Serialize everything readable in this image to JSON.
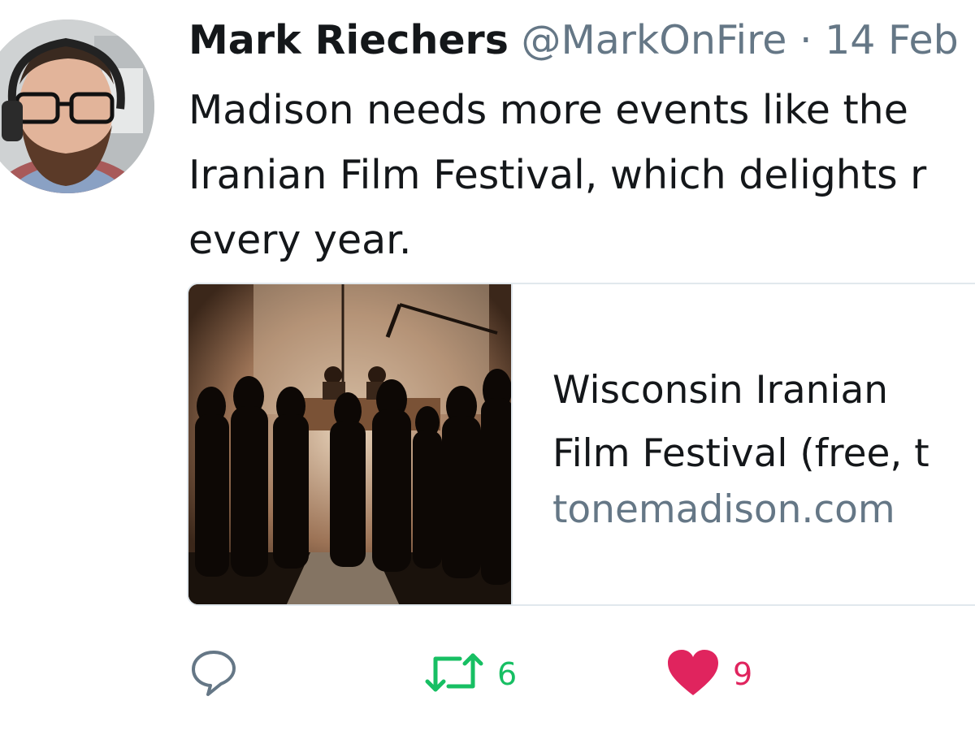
{
  "tweet": {
    "author_name": "Mark Riechers",
    "handle": "@MarkOnFire",
    "separator": "·",
    "timestamp": "14 Feb",
    "text_lines": [
      "Madison needs more events like the",
      "Iranian Film Festival, which delights r",
      "every year."
    ]
  },
  "card": {
    "title_lines": [
      "Wisconsin Iranian",
      "Film Festival (free, t"
    ],
    "domain": "tonemadison.com"
  },
  "actions": {
    "reply_icon": "reply-bubble-icon",
    "retweet_icon": "retweet-arrows-icon",
    "retweet_count": "6",
    "like_icon": "heart-icon",
    "like_count": "9"
  },
  "colors": {
    "text": "#14171a",
    "secondary": "#657786",
    "retweet_green": "#17bf63",
    "like_red": "#e0245e",
    "border": "#e1e8ed"
  }
}
